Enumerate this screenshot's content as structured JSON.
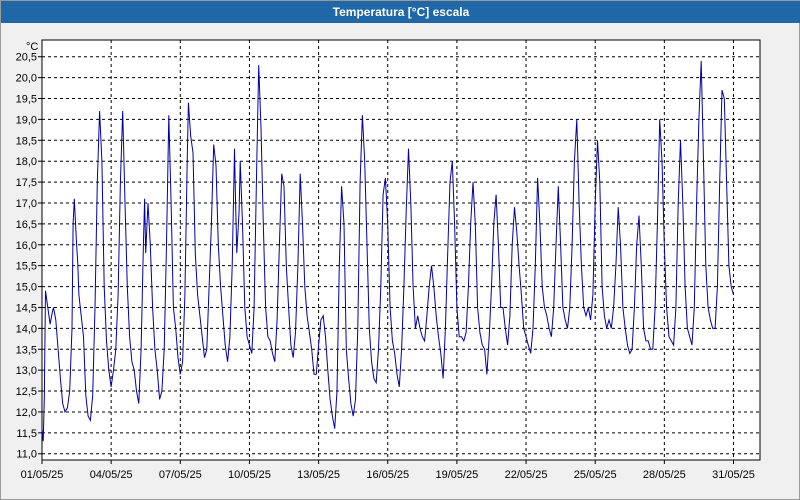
{
  "window": {
    "title": "Temperatura [°C] escala"
  },
  "chart_data": {
    "type": "line",
    "title": "Temperatura [°C] escala",
    "ylabel": "°C",
    "xlabel": "",
    "ylim": [
      10.85,
      20.9
    ],
    "xlim": [
      0,
      31.15
    ],
    "y_ticks": [
      "11,0",
      "11,5",
      "12,0",
      "12,5",
      "13,0",
      "13,5",
      "14,0",
      "14,5",
      "15,0",
      "15,5",
      "16,0",
      "16,5",
      "17,0",
      "17,5",
      "18,0",
      "18,5",
      "19,0",
      "19,5",
      "20,0",
      "20,5"
    ],
    "x_ticks": [
      "01/05/25",
      "04/05/25",
      "07/05/25",
      "10/05/25",
      "13/05/25",
      "16/05/25",
      "19/05/25",
      "22/05/25",
      "25/05/25",
      "28/05/25",
      "31/05/25"
    ],
    "grid": true,
    "line_color": "#0000aa",
    "series": [
      {
        "values": [
          [
            0.0,
            11.6
          ],
          [
            0.05,
            11.3
          ],
          [
            0.1,
            12.3
          ],
          [
            0.15,
            14.9
          ],
          [
            0.25,
            14.5
          ],
          [
            0.35,
            14.1
          ],
          [
            0.45,
            14.4
          ],
          [
            0.5,
            14.5
          ],
          [
            0.6,
            14.2
          ],
          [
            0.7,
            13.5
          ],
          [
            0.8,
            12.8
          ],
          [
            0.9,
            12.2
          ],
          [
            1.0,
            12.0
          ],
          [
            1.1,
            12.1
          ],
          [
            1.2,
            12.5
          ],
          [
            1.3,
            14.0
          ],
          [
            1.35,
            16.5
          ],
          [
            1.4,
            17.1
          ],
          [
            1.5,
            16.0
          ],
          [
            1.55,
            15.6
          ],
          [
            1.6,
            14.8
          ],
          [
            1.7,
            14.3
          ],
          [
            1.8,
            13.8
          ],
          [
            1.9,
            12.4
          ],
          [
            2.0,
            11.9
          ],
          [
            2.1,
            11.8
          ],
          [
            2.2,
            12.4
          ],
          [
            2.3,
            14.5
          ],
          [
            2.4,
            17.5
          ],
          [
            2.5,
            19.2
          ],
          [
            2.6,
            18.0
          ],
          [
            2.7,
            15.0
          ],
          [
            2.8,
            13.7
          ],
          [
            2.9,
            13.0
          ],
          [
            3.0,
            12.6
          ],
          [
            3.1,
            13.0
          ],
          [
            3.2,
            13.5
          ],
          [
            3.3,
            14.8
          ],
          [
            3.4,
            17.5
          ],
          [
            3.5,
            19.2
          ],
          [
            3.6,
            17.0
          ],
          [
            3.7,
            15.0
          ],
          [
            3.8,
            13.8
          ],
          [
            3.9,
            13.2
          ],
          [
            4.0,
            13.0
          ],
          [
            4.1,
            12.5
          ],
          [
            4.2,
            12.2
          ],
          [
            4.3,
            13.5
          ],
          [
            4.4,
            16.0
          ],
          [
            4.45,
            17.1
          ],
          [
            4.5,
            15.8
          ],
          [
            4.6,
            17.0
          ],
          [
            4.7,
            16.0
          ],
          [
            4.8,
            14.5
          ],
          [
            4.9,
            13.5
          ],
          [
            5.0,
            13.0
          ],
          [
            5.1,
            12.3
          ],
          [
            5.2,
            12.5
          ],
          [
            5.3,
            13.5
          ],
          [
            5.4,
            16.0
          ],
          [
            5.5,
            19.1
          ],
          [
            5.6,
            17.0
          ],
          [
            5.7,
            14.5
          ],
          [
            5.8,
            14.0
          ],
          [
            5.9,
            13.3
          ],
          [
            6.0,
            12.9
          ],
          [
            6.1,
            13.2
          ],
          [
            6.2,
            14.8
          ],
          [
            6.3,
            18.0
          ],
          [
            6.35,
            19.4
          ],
          [
            6.45,
            18.6
          ],
          [
            6.55,
            18.2
          ],
          [
            6.65,
            15.8
          ],
          [
            6.75,
            14.8
          ],
          [
            6.85,
            14.3
          ],
          [
            6.95,
            13.8
          ],
          [
            7.05,
            13.3
          ],
          [
            7.15,
            13.5
          ],
          [
            7.25,
            15.0
          ],
          [
            7.35,
            16.5
          ],
          [
            7.45,
            18.4
          ],
          [
            7.55,
            17.9
          ],
          [
            7.65,
            16.0
          ],
          [
            7.75,
            15.0
          ],
          [
            7.85,
            14.3
          ],
          [
            7.95,
            13.6
          ],
          [
            8.05,
            13.2
          ],
          [
            8.15,
            13.8
          ],
          [
            8.25,
            15.5
          ],
          [
            8.35,
            18.3
          ],
          [
            8.4,
            17.0
          ],
          [
            8.45,
            15.8
          ],
          [
            8.55,
            16.8
          ],
          [
            8.6,
            18.0
          ],
          [
            8.7,
            16.5
          ],
          [
            8.8,
            14.5
          ],
          [
            8.9,
            13.8
          ],
          [
            9.0,
            13.6
          ],
          [
            9.1,
            13.4
          ],
          [
            9.2,
            14.5
          ],
          [
            9.3,
            17.5
          ],
          [
            9.4,
            20.3
          ],
          [
            9.5,
            18.8
          ],
          [
            9.6,
            16.5
          ],
          [
            9.7,
            14.5
          ],
          [
            9.8,
            13.8
          ],
          [
            9.9,
            13.7
          ],
          [
            10.0,
            13.4
          ],
          [
            10.1,
            13.2
          ],
          [
            10.2,
            14.2
          ],
          [
            10.3,
            16.0
          ],
          [
            10.4,
            17.7
          ],
          [
            10.5,
            17.4
          ],
          [
            10.6,
            15.5
          ],
          [
            10.7,
            14.5
          ],
          [
            10.8,
            13.6
          ],
          [
            10.9,
            13.3
          ],
          [
            11.0,
            13.9
          ],
          [
            11.1,
            15.5
          ],
          [
            11.2,
            17.7
          ],
          [
            11.3,
            16.5
          ],
          [
            11.4,
            15.0
          ],
          [
            11.5,
            14.3
          ],
          [
            11.6,
            13.9
          ],
          [
            11.7,
            13.5
          ],
          [
            11.8,
            12.9
          ],
          [
            11.9,
            12.9
          ],
          [
            12.0,
            13.6
          ],
          [
            12.1,
            14.2
          ],
          [
            12.2,
            14.3
          ],
          [
            12.3,
            13.8
          ],
          [
            12.4,
            13.0
          ],
          [
            12.5,
            12.3
          ],
          [
            12.6,
            11.9
          ],
          [
            12.7,
            11.6
          ],
          [
            12.8,
            12.5
          ],
          [
            12.9,
            15.5
          ],
          [
            13.0,
            17.4
          ],
          [
            13.1,
            16.5
          ],
          [
            13.2,
            13.5
          ],
          [
            13.3,
            12.8
          ],
          [
            13.4,
            12.2
          ],
          [
            13.5,
            11.9
          ],
          [
            13.6,
            12.3
          ],
          [
            13.7,
            14.0
          ],
          [
            13.8,
            17.5
          ],
          [
            13.9,
            19.1
          ],
          [
            14.0,
            18.0
          ],
          [
            14.1,
            16.0
          ],
          [
            14.2,
            14.0
          ],
          [
            14.3,
            13.2
          ],
          [
            14.4,
            12.8
          ],
          [
            14.5,
            12.7
          ],
          [
            14.6,
            13.5
          ],
          [
            14.7,
            15.0
          ],
          [
            14.8,
            17.2
          ],
          [
            14.9,
            17.6
          ],
          [
            15.0,
            16.5
          ],
          [
            15.1,
            14.5
          ],
          [
            15.2,
            13.7
          ],
          [
            15.3,
            13.4
          ],
          [
            15.4,
            12.9
          ],
          [
            15.5,
            12.6
          ],
          [
            15.6,
            13.5
          ],
          [
            15.7,
            15.0
          ],
          [
            15.8,
            16.8
          ],
          [
            15.9,
            18.3
          ],
          [
            16.0,
            17.0
          ],
          [
            16.1,
            15.0
          ],
          [
            16.2,
            14.0
          ],
          [
            16.3,
            14.3
          ],
          [
            16.4,
            14.0
          ],
          [
            16.5,
            13.8
          ],
          [
            16.6,
            13.7
          ],
          [
            16.7,
            14.3
          ],
          [
            16.8,
            15.0
          ],
          [
            16.9,
            15.5
          ],
          [
            17.0,
            15.0
          ],
          [
            17.1,
            14.3
          ],
          [
            17.2,
            13.8
          ],
          [
            17.3,
            13.4
          ],
          [
            17.4,
            12.8
          ],
          [
            17.5,
            14.0
          ],
          [
            17.6,
            15.8
          ],
          [
            17.7,
            17.5
          ],
          [
            17.8,
            18.0
          ],
          [
            17.9,
            16.5
          ],
          [
            18.0,
            14.5
          ],
          [
            18.1,
            13.8
          ],
          [
            18.2,
            13.8
          ],
          [
            18.3,
            13.7
          ],
          [
            18.4,
            13.9
          ],
          [
            18.5,
            15.0
          ],
          [
            18.6,
            16.5
          ],
          [
            18.7,
            17.5
          ],
          [
            18.8,
            16.5
          ],
          [
            18.9,
            14.5
          ],
          [
            19.0,
            13.9
          ],
          [
            19.1,
            13.6
          ],
          [
            19.2,
            13.5
          ],
          [
            19.3,
            12.9
          ],
          [
            19.4,
            13.8
          ],
          [
            19.5,
            15.0
          ],
          [
            19.6,
            16.5
          ],
          [
            19.7,
            17.2
          ],
          [
            19.8,
            16.0
          ],
          [
            19.9,
            14.5
          ],
          [
            20.0,
            14.5
          ],
          [
            20.1,
            14.0
          ],
          [
            20.2,
            13.6
          ],
          [
            20.3,
            14.3
          ],
          [
            20.4,
            16.0
          ],
          [
            20.5,
            16.9
          ],
          [
            20.6,
            16.3
          ],
          [
            20.7,
            15.5
          ],
          [
            20.8,
            14.8
          ],
          [
            20.9,
            14.0
          ],
          [
            21.0,
            13.8
          ],
          [
            21.1,
            13.6
          ],
          [
            21.2,
            13.4
          ],
          [
            21.3,
            14.0
          ],
          [
            21.4,
            15.5
          ],
          [
            21.5,
            17.6
          ],
          [
            21.6,
            16.5
          ],
          [
            21.7,
            15.0
          ],
          [
            21.8,
            14.5
          ],
          [
            21.9,
            14.3
          ],
          [
            22.0,
            14.0
          ],
          [
            22.1,
            13.8
          ],
          [
            22.2,
            14.5
          ],
          [
            22.3,
            16.0
          ],
          [
            22.4,
            17.4
          ],
          [
            22.5,
            16.0
          ],
          [
            22.6,
            14.5
          ],
          [
            22.7,
            14.2
          ],
          [
            22.8,
            14.0
          ],
          [
            22.9,
            14.5
          ],
          [
            23.0,
            16.0
          ],
          [
            23.1,
            18.0
          ],
          [
            23.2,
            19.0
          ],
          [
            23.3,
            17.0
          ],
          [
            23.4,
            15.5
          ],
          [
            23.5,
            14.5
          ],
          [
            23.6,
            14.3
          ],
          [
            23.7,
            14.5
          ],
          [
            23.8,
            14.2
          ],
          [
            23.9,
            14.8
          ],
          [
            24.0,
            17.0
          ],
          [
            24.1,
            18.5
          ],
          [
            24.2,
            17.5
          ],
          [
            24.3,
            15.0
          ],
          [
            24.4,
            14.3
          ],
          [
            24.5,
            14.0
          ],
          [
            24.6,
            14.2
          ],
          [
            24.7,
            14.0
          ],
          [
            24.8,
            14.5
          ],
          [
            24.9,
            15.5
          ],
          [
            25.0,
            16.9
          ],
          [
            25.1,
            16.0
          ],
          [
            25.2,
            14.5
          ],
          [
            25.3,
            14.0
          ],
          [
            25.4,
            13.6
          ],
          [
            25.5,
            13.4
          ],
          [
            25.6,
            13.5
          ],
          [
            25.7,
            14.5
          ],
          [
            25.8,
            16.0
          ],
          [
            25.9,
            16.7
          ],
          [
            26.0,
            15.5
          ],
          [
            26.1,
            14.0
          ],
          [
            26.2,
            13.7
          ],
          [
            26.3,
            13.7
          ],
          [
            26.4,
            13.5
          ],
          [
            26.5,
            13.5
          ],
          [
            26.6,
            14.5
          ],
          [
            26.7,
            16.5
          ],
          [
            26.8,
            19.0
          ],
          [
            26.9,
            18.0
          ],
          [
            27.0,
            16.0
          ],
          [
            27.1,
            14.5
          ],
          [
            27.2,
            13.8
          ],
          [
            27.3,
            13.7
          ],
          [
            27.4,
            13.6
          ],
          [
            27.5,
            14.5
          ],
          [
            27.6,
            17.0
          ],
          [
            27.7,
            18.5
          ],
          [
            27.8,
            17.0
          ],
          [
            27.9,
            15.0
          ],
          [
            28.0,
            14.0
          ],
          [
            28.1,
            13.8
          ],
          [
            28.2,
            13.6
          ],
          [
            28.3,
            14.5
          ],
          [
            28.4,
            17.0
          ],
          [
            28.5,
            19.0
          ],
          [
            28.6,
            20.4
          ],
          [
            28.7,
            18.0
          ],
          [
            28.8,
            15.5
          ],
          [
            28.9,
            14.5
          ],
          [
            29.0,
            14.2
          ],
          [
            29.1,
            14.0
          ],
          [
            29.2,
            14.0
          ],
          [
            29.3,
            15.0
          ],
          [
            29.4,
            17.5
          ],
          [
            29.5,
            19.7
          ],
          [
            29.6,
            19.5
          ],
          [
            29.7,
            17.5
          ],
          [
            29.8,
            15.5
          ],
          [
            29.9,
            15.0
          ],
          [
            30.0,
            14.8
          ]
        ]
      }
    ]
  }
}
